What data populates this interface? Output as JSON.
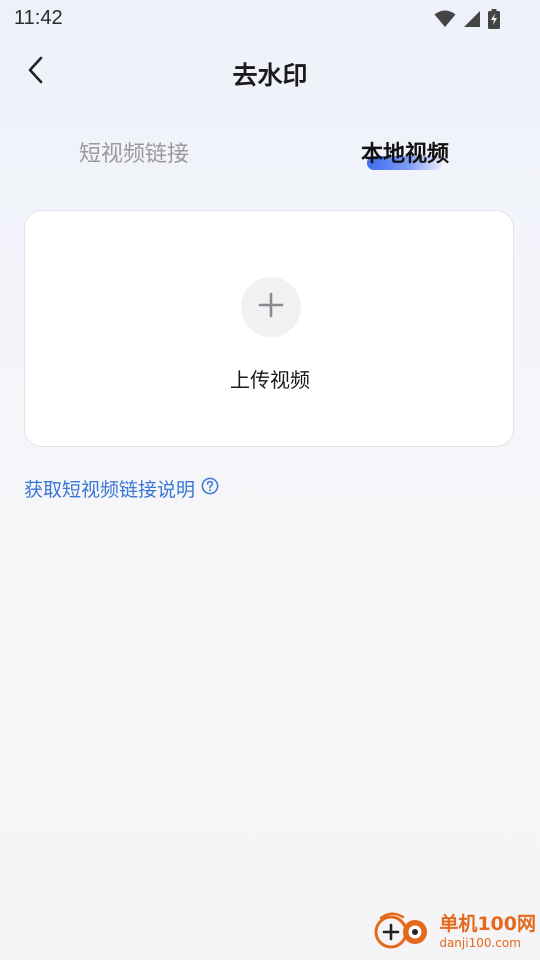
{
  "status_bar": {
    "time": "11:42",
    "icons": [
      "wifi-icon",
      "cellular-signal-icon",
      "battery-charging-icon"
    ]
  },
  "header": {
    "back_icon": "chevron-left-icon",
    "title": "去水印"
  },
  "tabs": [
    {
      "label": "短视频链接",
      "active": false
    },
    {
      "label": "本地视频",
      "active": true
    }
  ],
  "upload": {
    "icon": "plus-icon",
    "label": "上传视频"
  },
  "help": {
    "text": "获取短视频链接说明",
    "icon": "question-circle-icon"
  },
  "colors": {
    "accent": "#3f6bf0",
    "link": "#3a76d6",
    "watermark": "#e36a1c"
  },
  "watermark": {
    "name": "单机100网",
    "url": "danji100.com"
  }
}
